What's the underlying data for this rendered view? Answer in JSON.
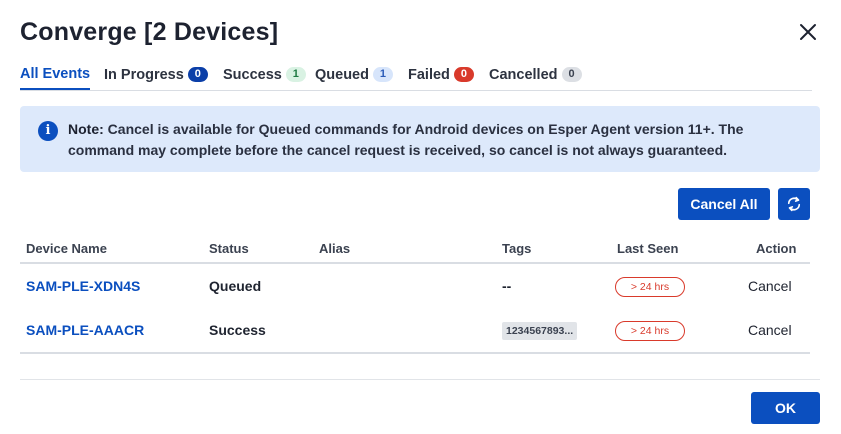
{
  "dialog": {
    "title": "Converge [2 Devices]",
    "close_icon": "close-icon"
  },
  "tabs": [
    {
      "label": "All Events",
      "count": null,
      "active": true
    },
    {
      "label": "In Progress",
      "count": "0",
      "badge_color": "#0b3fa8"
    },
    {
      "label": "Success",
      "count": "1",
      "badge_color": "#d9f2e3"
    },
    {
      "label": "Queued",
      "count": "1",
      "badge_color": "#d7e5fb"
    },
    {
      "label": "Failed",
      "count": "0",
      "badge_color": "#d93a2b"
    },
    {
      "label": "Cancelled",
      "count": "0",
      "badge_color": "#dcdfe4"
    }
  ],
  "note": {
    "icon": "info-icon",
    "label": "Note:",
    "text": "Cancel is available for Queued commands for Android devices on Esper Agent version 11+. The command may complete before the cancel request is received, so cancel is not always guaranteed."
  },
  "toolbar": {
    "cancel_all_label": "Cancel All",
    "refresh_icon": "refresh-icon"
  },
  "table": {
    "columns": [
      "Device Name",
      "Status",
      "Alias",
      "Tags",
      "Last Seen",
      "Action"
    ],
    "rows": [
      {
        "device": "SAM-PLE-XDN4S",
        "status": "Queued",
        "alias": "",
        "tags": "--",
        "last_seen": "> 24 hrs",
        "action": "Cancel",
        "action_enabled": true
      },
      {
        "device": "SAM-PLE-AAACR",
        "status": "Success",
        "alias": "",
        "tags": "1234567893...",
        "last_seen": "> 24 hrs",
        "action": "Cancel",
        "action_enabled": false
      }
    ]
  },
  "footer": {
    "ok_label": "OK"
  },
  "colors": {
    "accent": "#0b4fbf",
    "note_bg": "#dde9fb",
    "danger": "#d93a2b"
  }
}
